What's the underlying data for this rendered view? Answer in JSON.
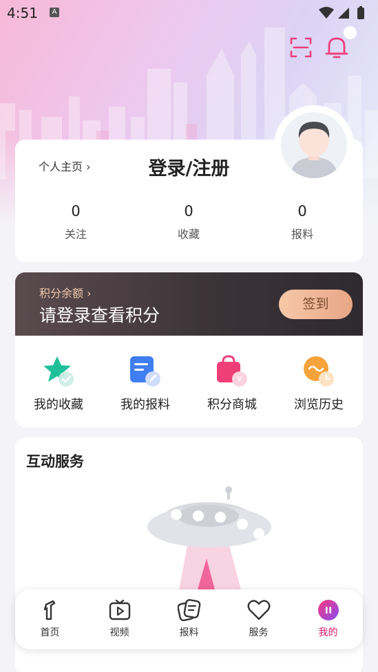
{
  "status_bar": {
    "time": "4:51",
    "notif_letter": "A"
  },
  "header": {
    "scan_icon": "scan-icon",
    "bell_icon": "bell-icon",
    "accent": "#ee3f7d"
  },
  "profile": {
    "homepage_label": "个人主页 ›",
    "login_label": "登录/注册",
    "stats": [
      {
        "value": "0",
        "label": "关注"
      },
      {
        "value": "0",
        "label": "收藏"
      },
      {
        "value": "0",
        "label": "报料"
      }
    ]
  },
  "points": {
    "balance_label": "积分余额 ›",
    "hint": "请登录查看积分",
    "checkin_label": "签到"
  },
  "quick_links": [
    {
      "label": "我的收藏",
      "icon": "star-icon"
    },
    {
      "label": "我的报料",
      "icon": "report-icon"
    },
    {
      "label": "积分商城",
      "icon": "shopping-bag-icon"
    },
    {
      "label": "浏览历史",
      "icon": "history-icon"
    }
  ],
  "service": {
    "title": "互动服务"
  },
  "tabs": [
    {
      "label": "首页",
      "icon": "home-icon",
      "active": false
    },
    {
      "label": "视频",
      "icon": "video-icon",
      "active": false
    },
    {
      "label": "报料",
      "icon": "report-tab-icon",
      "active": false
    },
    {
      "label": "服务",
      "icon": "heart-icon",
      "active": false
    },
    {
      "label": "我的",
      "icon": "profile-tab-icon",
      "active": true
    }
  ]
}
